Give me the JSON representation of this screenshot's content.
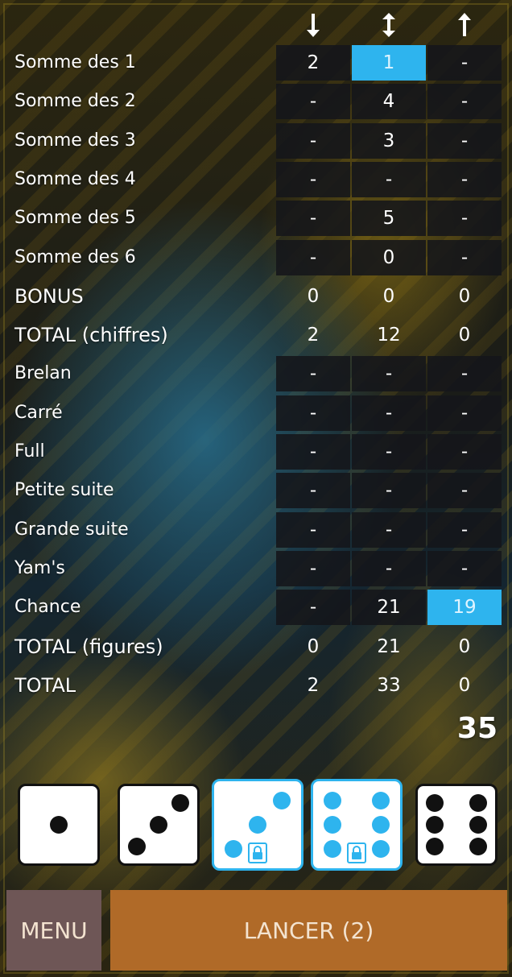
{
  "columns": [
    {
      "icon": "arrow-down-icon"
    },
    {
      "icon": "arrow-updown-icon"
    },
    {
      "icon": "arrow-up-icon"
    }
  ],
  "rows": [
    {
      "label": "Somme des 1",
      "values": [
        "2",
        "1",
        "-"
      ],
      "boxed": true,
      "selected": [
        false,
        true,
        false
      ]
    },
    {
      "label": "Somme des 2",
      "values": [
        "-",
        "4",
        "-"
      ],
      "boxed": true,
      "selected": [
        false,
        false,
        false
      ]
    },
    {
      "label": "Somme des 3",
      "values": [
        "-",
        "3",
        "-"
      ],
      "boxed": true,
      "selected": [
        false,
        false,
        false
      ]
    },
    {
      "label": "Somme des 4",
      "values": [
        "-",
        "-",
        "-"
      ],
      "boxed": true,
      "selected": [
        false,
        false,
        false
      ]
    },
    {
      "label": "Somme des 5",
      "values": [
        "-",
        "5",
        "-"
      ],
      "boxed": true,
      "selected": [
        false,
        false,
        false
      ]
    },
    {
      "label": "Somme des 6",
      "values": [
        "-",
        "0",
        "-"
      ],
      "boxed": true,
      "selected": [
        false,
        false,
        false
      ]
    },
    {
      "label": "BONUS",
      "values": [
        "0",
        "0",
        "0"
      ],
      "boxed": false,
      "selected": [
        false,
        false,
        false
      ]
    },
    {
      "label": "TOTAL (chiffres)",
      "values": [
        "2",
        "12",
        "0"
      ],
      "boxed": false,
      "selected": [
        false,
        false,
        false
      ]
    },
    {
      "label": "Brelan",
      "values": [
        "-",
        "-",
        "-"
      ],
      "boxed": true,
      "selected": [
        false,
        false,
        false
      ]
    },
    {
      "label": "Carré",
      "values": [
        "-",
        "-",
        "-"
      ],
      "boxed": true,
      "selected": [
        false,
        false,
        false
      ]
    },
    {
      "label": "Full",
      "values": [
        "-",
        "-",
        "-"
      ],
      "boxed": true,
      "selected": [
        false,
        false,
        false
      ]
    },
    {
      "label": "Petite suite",
      "values": [
        "-",
        "-",
        "-"
      ],
      "boxed": true,
      "selected": [
        false,
        false,
        false
      ]
    },
    {
      "label": "Grande suite",
      "values": [
        "-",
        "-",
        "-"
      ],
      "boxed": true,
      "selected": [
        false,
        false,
        false
      ]
    },
    {
      "label": "Yam's",
      "values": [
        "-",
        "-",
        "-"
      ],
      "boxed": true,
      "selected": [
        false,
        false,
        false
      ]
    },
    {
      "label": "Chance",
      "values": [
        "-",
        "21",
        "19"
      ],
      "boxed": true,
      "selected": [
        false,
        false,
        true
      ]
    },
    {
      "label": "TOTAL (figures)",
      "values": [
        "0",
        "21",
        "0"
      ],
      "boxed": false,
      "selected": [
        false,
        false,
        false
      ]
    },
    {
      "label": "TOTAL",
      "values": [
        "2",
        "33",
        "0"
      ],
      "boxed": false,
      "selected": [
        false,
        false,
        false
      ]
    }
  ],
  "grand_total": "35",
  "dice": [
    {
      "value": 1,
      "locked": false
    },
    {
      "value": 3,
      "locked": false
    },
    {
      "value": 3,
      "locked": true
    },
    {
      "value": 6,
      "locked": true
    },
    {
      "value": 6,
      "locked": false
    }
  ],
  "buttons": {
    "menu_label": "MENU",
    "roll_label": "LANCER (2)"
  },
  "colors": {
    "highlight": "#2eb4ee",
    "menu_button": "#6e5656",
    "roll_button": "#b06a28",
    "cell_background": "#141618"
  }
}
